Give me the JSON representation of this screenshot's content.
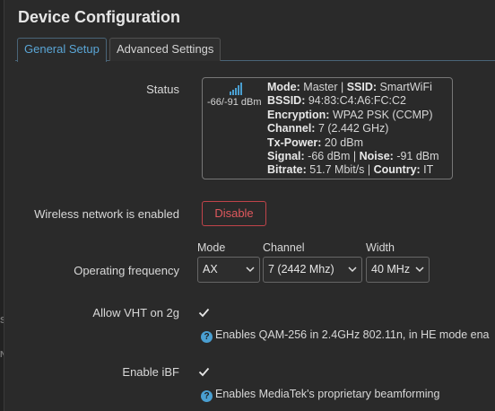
{
  "dialog": {
    "title": "Device Configuration"
  },
  "tabs": [
    {
      "label": "General Setup",
      "active": true
    },
    {
      "label": "Advanced Settings",
      "active": false
    }
  ],
  "status": {
    "label": "Status",
    "signal_text": "-66/-91 dBm",
    "mode_label": "Mode:",
    "mode_value": "Master",
    "ssid_label": "SSID:",
    "ssid_value": "SmartWiFi",
    "bssid_label": "BSSID:",
    "bssid_value": "94:83:C4:A6:FC:C2",
    "enc_label": "Encryption:",
    "enc_value": "WPA2 PSK (CCMP)",
    "channel_label": "Channel:",
    "channel_value": "7 (2.442 GHz)",
    "txpower_label": "Tx-Power:",
    "txpower_value": "20 dBm",
    "signal_label": "Signal:",
    "signal_value": "-66 dBm",
    "noise_label": "Noise:",
    "noise_value": "-91 dBm",
    "bitrate_label": "Bitrate:",
    "bitrate_value": "51.7 Mbit/s",
    "country_label": "Country:",
    "country_value": "IT",
    "separator": "|"
  },
  "wireless": {
    "label": "Wireless network is enabled",
    "button": "Disable"
  },
  "frequency": {
    "label": "Operating frequency",
    "mode_head": "Mode",
    "mode_value": "AX",
    "channel_head": "Channel",
    "channel_value": "7 (2442 Mhz)",
    "width_head": "Width",
    "width_value": "40 MHz"
  },
  "vht": {
    "label": "Allow VHT on 2g",
    "checked": true,
    "help": "Enables QAM-256 in 2.4GHz 802.11n, in HE mode ena"
  },
  "ibf": {
    "label": "Enable iBF",
    "checked": true,
    "help": "Enables MediaTek's proprietary beamforming"
  },
  "edge_ghosts": [
    "S",
    "N"
  ],
  "colors": {
    "accent": "#5aa6d6",
    "danger": "#e0585d",
    "help_icon": "#4a9fd1"
  },
  "icons": {
    "signal": "signal-strength-icon",
    "help": "help-circle-icon",
    "dropdown": "chevron-down-icon",
    "check": "check-icon"
  }
}
